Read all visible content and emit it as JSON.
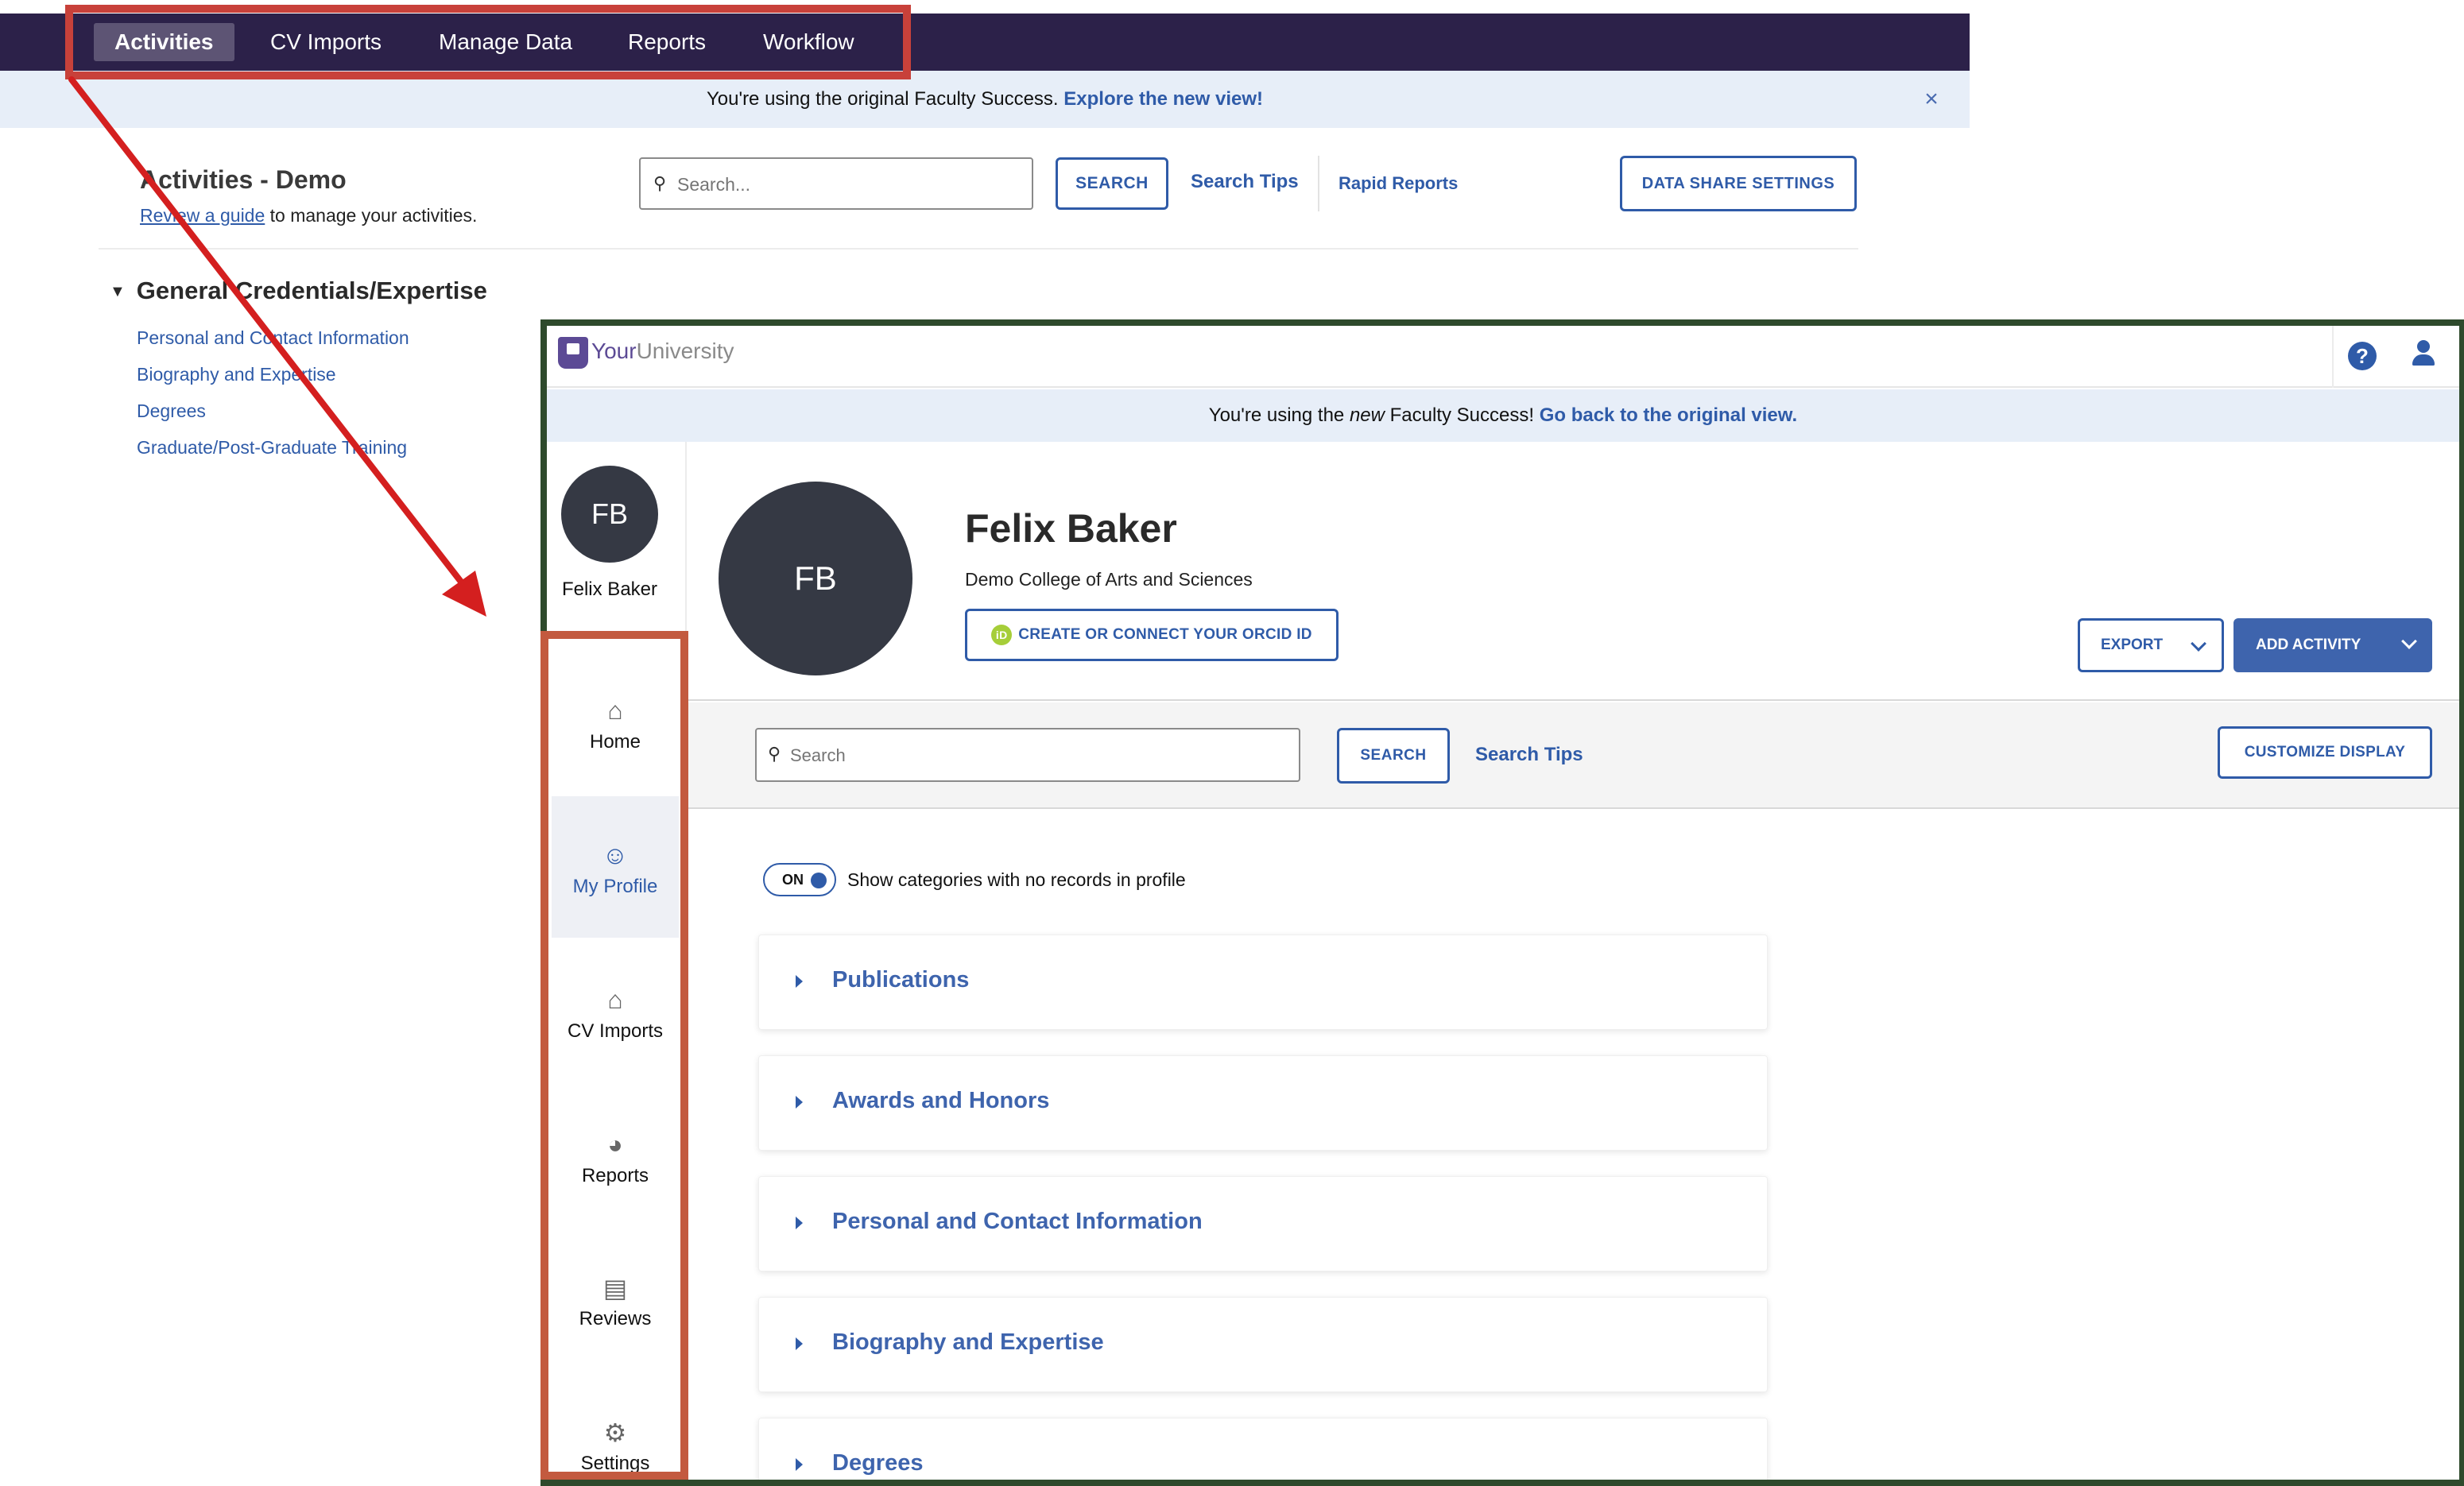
{
  "old_view": {
    "nav": [
      "Activities",
      "CV Imports",
      "Manage Data",
      "Reports",
      "Workflow"
    ],
    "banner": {
      "text": "You're using the original Faculty Success. ",
      "link": "Explore the new view!"
    },
    "close_icon": "×",
    "title": "Activities - Demo",
    "guide": {
      "link": "Review a guide",
      "suffix": " to manage your activities."
    },
    "search": {
      "placeholder": "Search..."
    },
    "search_button": "SEARCH",
    "search_tips": "Search Tips",
    "rapid_reports": "Rapid Reports",
    "data_share_button": "DATA SHARE SETTINGS",
    "section_title": "General Credentials/Expertise",
    "section_links": [
      "Personal and Contact Information",
      "Biography and Expertise",
      "Degrees",
      "Graduate/Post-Graduate Training"
    ]
  },
  "new_view": {
    "brand": {
      "prefix": "Your",
      "suffix": "University"
    },
    "help_icon": "?",
    "banner": {
      "pre": "You're using the ",
      "em": "new",
      "mid": " Faculty Success! ",
      "link": "Go back to the original view."
    },
    "sidebar": {
      "initials": "FB",
      "name": "Felix Baker",
      "items": [
        {
          "label": "Home",
          "icon": "home-icon"
        },
        {
          "label": "My Profile",
          "icon": "person-icon"
        },
        {
          "label": "CV Imports",
          "icon": "home-icon"
        },
        {
          "label": "Reports",
          "icon": "pie-chart-icon"
        },
        {
          "label": "Reviews",
          "icon": "document-icon"
        },
        {
          "label": "Settings",
          "icon": "gear-icon"
        }
      ]
    },
    "profile": {
      "initials": "FB",
      "name": "Felix Baker",
      "college": "Demo College of Arts and Sciences",
      "orcid_button": "CREATE OR CONNECT YOUR ORCID ID",
      "orcid_badge": "iD",
      "export_button": "EXPORT",
      "add_activity_button": "ADD ACTIVITY"
    },
    "search": {
      "placeholder": "Search"
    },
    "search_button": "SEARCH",
    "search_tips": "Search Tips",
    "customize_button": "CUSTOMIZE DISPLAY",
    "toggle": {
      "state": "ON",
      "label": "Show categories with no records in profile"
    },
    "categories": [
      "Publications",
      "Awards and Honors",
      "Personal and Contact Information",
      "Biography and Expertise",
      "Degrees"
    ]
  },
  "colors": {
    "nav_bar": "#2c2149",
    "link_blue": "#2f5ba8",
    "annotation_red": "#c8413a",
    "annotation_green": "#2e4a2c"
  }
}
